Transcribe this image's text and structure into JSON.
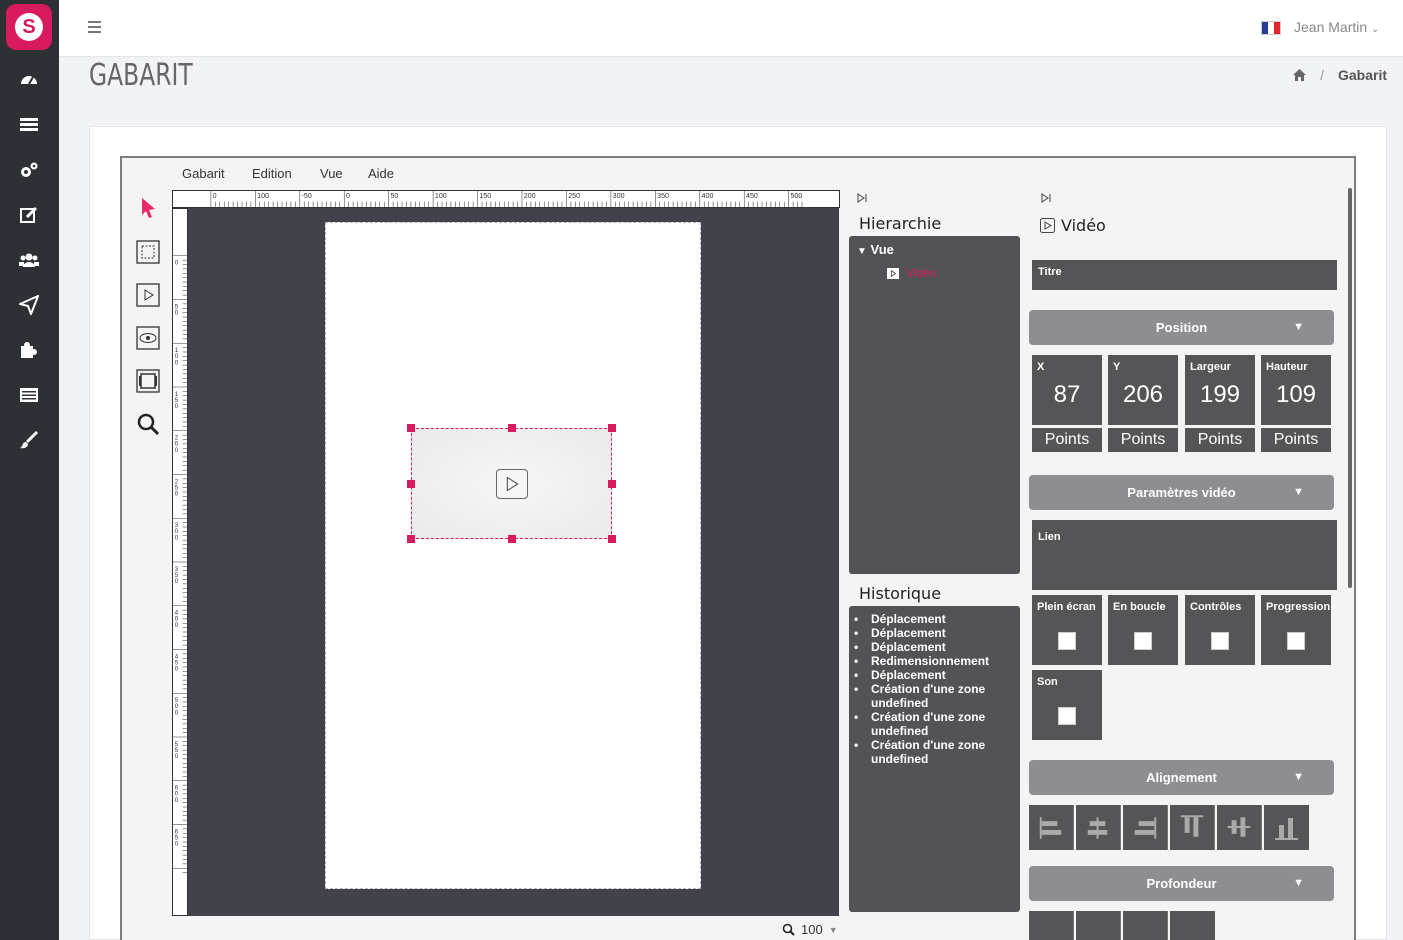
{
  "app": {
    "logo_letter": "S"
  },
  "header": {
    "user_name": "Jean Martin"
  },
  "page": {
    "title": "GABARIT",
    "breadcrumb_current": "Gabarit"
  },
  "editor": {
    "menu": [
      "Gabarit",
      "Edition",
      "Vue",
      "Aide"
    ],
    "ruler_top_labels": [
      "0",
      "100",
      "-50",
      "0",
      "50",
      "100",
      "150",
      "200",
      "250",
      "300",
      "350",
      "400",
      "450",
      "500"
    ],
    "ruler_left_labels": [
      "0",
      "50",
      "100",
      "150",
      "200",
      "250",
      "300",
      "350",
      "400",
      "450",
      "500",
      "550",
      "600",
      "650"
    ],
    "zoom_value": "100"
  },
  "hierarchy": {
    "title": "Hierarchie",
    "root": "Vue",
    "child": "Vidéo"
  },
  "history": {
    "title": "Historique",
    "items": [
      "Déplacement",
      "Déplacement",
      "Déplacement",
      "Redimensionnement",
      "Déplacement",
      "Création d'une zone undefined",
      "Création d'une zone undefined",
      "Création d'une zone undefined"
    ]
  },
  "properties": {
    "title": "Vidéo",
    "titre_label": "Titre",
    "position": {
      "header": "Position",
      "fields": [
        {
          "label": "X",
          "value": "87",
          "unit": "Points"
        },
        {
          "label": "Y",
          "value": "206",
          "unit": "Points"
        },
        {
          "label": "Largeur",
          "value": "199",
          "unit": "Points"
        },
        {
          "label": "Hauteur",
          "value": "109",
          "unit": "Points"
        }
      ]
    },
    "video_params": {
      "header": "Paramètres vidéo",
      "lien_label": "Lien",
      "options": [
        "Plein écran",
        "En boucle",
        "Contrôles",
        "Progression",
        "Son"
      ]
    },
    "alignment": {
      "header": "Alignement"
    },
    "depth": {
      "header": "Profondeur"
    }
  }
}
